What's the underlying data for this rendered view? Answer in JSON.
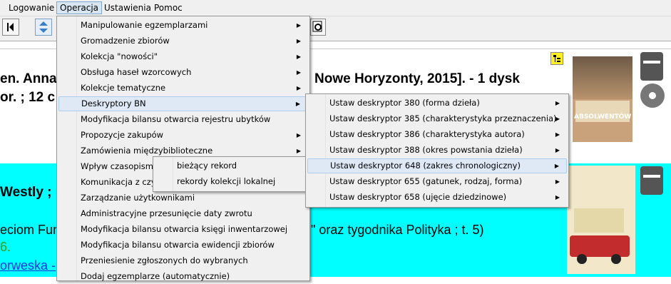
{
  "menubar": {
    "items": [
      "Logowanie",
      "Operacja",
      "Ustawienia",
      "Pomoc"
    ]
  },
  "operacja_menu": {
    "items": [
      {
        "label": "Manipulowanie egzemplarzami",
        "submenu": true
      },
      {
        "label": "Gromadzenie zbiorów",
        "submenu": true
      },
      {
        "label": "Kolekcja \"nowości\"",
        "submenu": true
      },
      {
        "label": "Obsługa haseł wzorcowych",
        "submenu": true
      },
      {
        "label": "Kolekcje tematyczne",
        "submenu": true
      },
      {
        "label": "Deskryptory BN",
        "submenu": true
      },
      {
        "label": "Modyfikacja bilansu otwarcia rejestru ubytków",
        "submenu": false
      },
      {
        "label": "Propozycje zakupów",
        "submenu": true
      },
      {
        "label": "Zamówienia międzybiblioteczne",
        "submenu": true
      },
      {
        "label": "Wpływ czasopism",
        "submenu": false
      },
      {
        "label": "Komunikacja z czyt",
        "submenu": false
      },
      {
        "label": "Zarządzanie użytkownikami",
        "submenu": false
      },
      {
        "label": "Administracyjne przesunięcie daty zwrotu",
        "submenu": false
      },
      {
        "label": "Modyfikacja bilansu otwarcia księgi inwentarzowej",
        "submenu": false
      },
      {
        "label": "Modyfikacja bilansu otwarcia ewidencji zbiorów",
        "submenu": false
      },
      {
        "label": "Przeniesienie zgłoszonych do wybranych",
        "submenu": false
      },
      {
        "label": "Dodaj egzemplarze (automatycznie)",
        "submenu": false
      }
    ]
  },
  "deskryptory_menu": {
    "items": [
      "Ustaw deskryptor 380 (forma dzieła)",
      "Ustaw deskryptor 385 (charakterystyka przeznaczenia)",
      "Ustaw deskryptor 386 (charakterystyka autora)",
      "Ustaw deskryptor 388 (okres powstania dzieła)",
      "Ustaw deskryptor 648 (zakres chronologiczny)",
      "Ustaw deskryptor 655 (gatunek, rodzaj, forma)",
      "Ustaw deskryptor 658 (ujęcie dziedzinowe)"
    ]
  },
  "wplyw_menu": {
    "items": [
      "bieżący rekord",
      "rekordy kolekcji lokalnej"
    ]
  },
  "record1": {
    "line1_left": "en. Anna",
    "line1_right": "Nowe Horyzonty, 2015]. - 1 dysk",
    "line2_left": "or. ; 12 c",
    "cover_title": "ABSOLWENTÓW"
  },
  "record2": {
    "line1": "Westly ; p",
    "line2_left": "eciom Fun",
    "line2_right": "\" oraz tygodnika Polityka ; t. 5)",
    "line3": "6.",
    "line4": "orweska -"
  },
  "colors": {
    "highlight_row": "#00ffff",
    "menu_bg": "#f0f0f0",
    "menu_highlight": "#dfe9f5"
  }
}
